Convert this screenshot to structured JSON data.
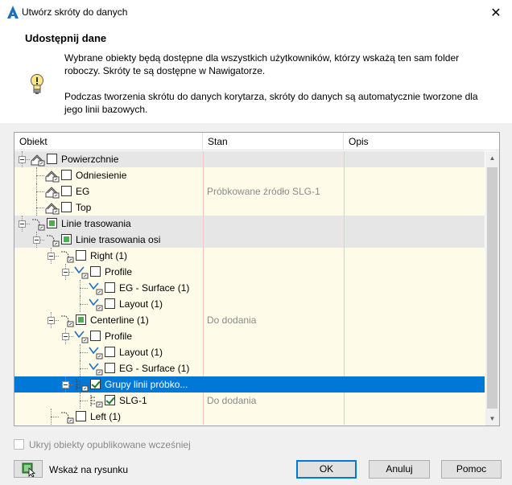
{
  "window": {
    "title": "Utwórz skróty do danych",
    "close_label": "✕"
  },
  "header": {
    "heading": "Udostępnij dane",
    "text1": "Wybrane obiekty będą dostępne dla wszystkich użytkowników, którzy wskażą ten sam folder roboczy. Skróty te są dostępne w Nawigatorze.",
    "text2": "Podczas tworzenia skrótu do danych korytarza, skróty do danych są automatycznie tworzone dla jego linii bazowych."
  },
  "tree": {
    "columns": [
      "Obiekt",
      "Stan",
      "Opis"
    ],
    "rows": [
      {
        "label": "Powierzchnie",
        "state": "",
        "checkbox": "unchecked",
        "icon": "surface-icon"
      },
      {
        "label": "Odniesienie",
        "state": "",
        "checkbox": "unchecked",
        "icon": "surface-icon"
      },
      {
        "label": "EG",
        "state": "Próbkowane źródło SLG-1",
        "checkbox": "unchecked",
        "icon": "surface-icon"
      },
      {
        "label": "Top",
        "state": "",
        "checkbox": "unchecked",
        "icon": "surface-icon"
      },
      {
        "label": "Linie trasowania",
        "state": "",
        "checkbox": "partial",
        "icon": "alignment-icon"
      },
      {
        "label": "Linie trasowania osi",
        "state": "",
        "checkbox": "partial",
        "icon": "alignment-icon"
      },
      {
        "label": "Right (1)",
        "state": "",
        "checkbox": "unchecked",
        "icon": "alignment-icon"
      },
      {
        "label": "Profile",
        "state": "",
        "checkbox": "unchecked",
        "icon": "profile-icon"
      },
      {
        "label": "EG - Surface (1)",
        "state": "",
        "checkbox": "unchecked",
        "icon": "profile-icon"
      },
      {
        "label": "Layout (1)",
        "state": "",
        "checkbox": "unchecked",
        "icon": "profile-icon"
      },
      {
        "label": "Centerline (1)",
        "state": "Do dodania",
        "checkbox": "partial",
        "icon": "alignment-icon"
      },
      {
        "label": "Profile",
        "state": "",
        "checkbox": "unchecked",
        "icon": "profile-icon"
      },
      {
        "label": "Layout (1)",
        "state": "",
        "checkbox": "unchecked",
        "icon": "profile-icon"
      },
      {
        "label": "EG - Surface (1)",
        "state": "",
        "checkbox": "unchecked",
        "icon": "profile-icon"
      },
      {
        "label": "Grupy linii próbko...",
        "state": "",
        "checkbox": "checked",
        "icon": "sample-line-group-icon"
      },
      {
        "label": "SLG-1",
        "state": "Do dodania",
        "checkbox": "checked",
        "icon": "sample-line-group-icon"
      },
      {
        "label": "Left (1)",
        "state": "",
        "checkbox": "unchecked",
        "icon": "alignment-icon"
      }
    ]
  },
  "options": {
    "hide_published": "Ukryj obiekty opublikowane wcześniej"
  },
  "buttons": {
    "pick": "Wskaż na rysunku",
    "ok": "OK",
    "cancel": "Anuluj",
    "help": "Pomoc"
  },
  "colors": {
    "selection": "#0078d7",
    "row_yellow": "#fefce8",
    "row_gray": "#e6e6e6",
    "autocad_red": "#cc2229"
  }
}
